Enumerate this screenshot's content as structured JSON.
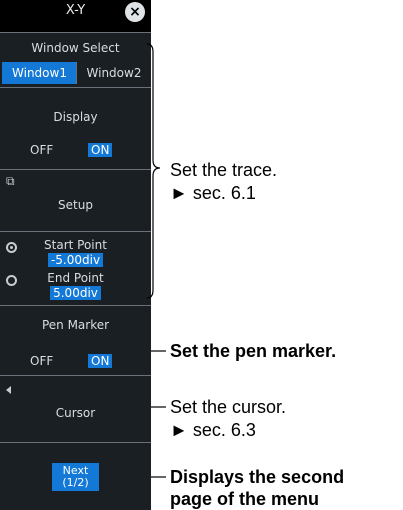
{
  "menu": {
    "title": "X-Y",
    "window_select": {
      "label": "Window Select",
      "options": [
        "Window1",
        "Window2"
      ],
      "selected": "Window1"
    },
    "display": {
      "label": "Display",
      "off": "OFF",
      "on": "ON",
      "value": "ON"
    },
    "setup": {
      "label": "Setup"
    },
    "start_point": {
      "label": "Start Point",
      "value": "-5.00div"
    },
    "end_point": {
      "label": "End Point",
      "value": "5.00div"
    },
    "pen_marker": {
      "label": "Pen Marker",
      "off": "OFF",
      "on": "ON",
      "value": "ON"
    },
    "cursor": {
      "label": "Cursor"
    },
    "next": {
      "label": "Next",
      "page": "(1/2)"
    }
  },
  "annotations": {
    "trace": {
      "line1": "Set the trace.",
      "line2": "► sec. 6.1"
    },
    "pen_marker": "Set the pen marker.",
    "cursor": {
      "line1": "Set the cursor.",
      "line2": "► sec. 6.3"
    },
    "next": {
      "line1": "Displays the second",
      "line2": "page of the menu"
    }
  }
}
